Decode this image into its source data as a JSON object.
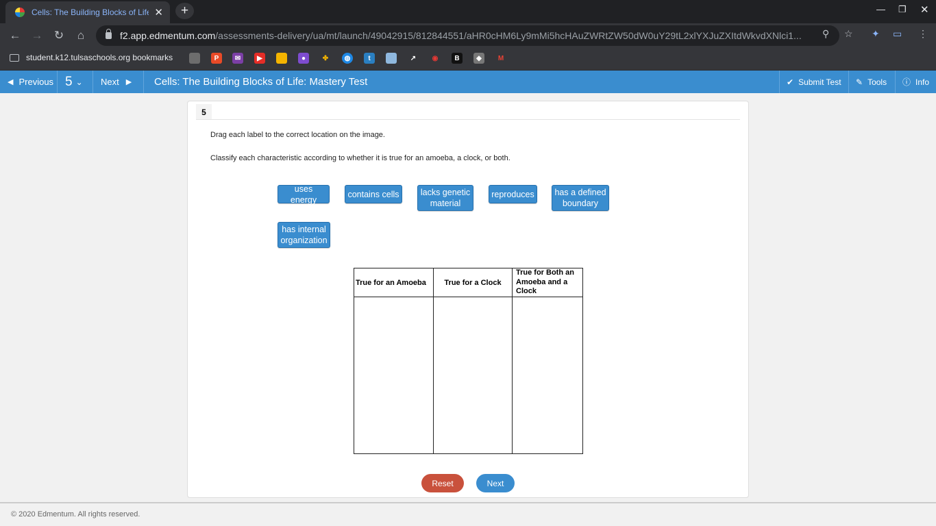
{
  "browser": {
    "tab_title": "Cells: The Building Blocks of Life",
    "new_tab": "+",
    "url_host": "f2.app.edmentum.com",
    "url_path": "/assessments-delivery/ua/mt/launch/49042915/812844551/aHR0cHM6Ly9mMi5hcHAuZWRtZW50dW0uY29tL2xlYXJuZXItdWkvdXNlci1...",
    "bookmarks_folder": "student.k12.tulsaschools.org bookmarks"
  },
  "header": {
    "previous_label": "Previous",
    "question_number": "5",
    "next_label": "Next",
    "title": "Cells: The Building Blocks of Life: Mastery Test",
    "submit_label": "Submit Test",
    "tools_label": "Tools",
    "info_label": "Info"
  },
  "question": {
    "number": "5",
    "instruction1": "Drag each label to the correct location on the image.",
    "instruction2": "Classify each characteristic according to whether it is true for an amoeba, a clock, or both.",
    "labels": {
      "uses_energy": "uses energy",
      "contains_cells": "contains cells",
      "lacks_genetic_material": "lacks genetic material",
      "reproduces": "reproduces",
      "defined_boundary": "has a defined boundary",
      "internal_organization": "has internal organization"
    },
    "columns": {
      "amoeba": "True for an Amoeba",
      "clock": "True for a Clock",
      "both": "True for Both an Amoeba and a Clock"
    },
    "reset_label": "Reset",
    "next_label": "Next"
  },
  "footer": "© 2020 Edmentum. All rights reserved."
}
